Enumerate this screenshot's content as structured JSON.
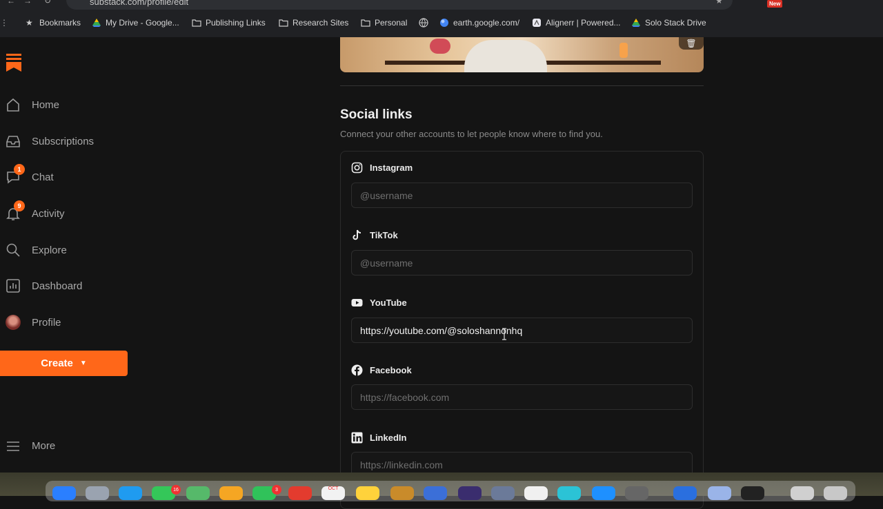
{
  "browser": {
    "url": "substack.com/profile/edit",
    "new_badge": "New",
    "bookmarks": [
      {
        "label": "Bookmarks",
        "icon": "star-icon"
      },
      {
        "label": "My Drive - Google...",
        "icon": "google-drive-icon"
      },
      {
        "label": "Publishing Links",
        "icon": "folder-icon"
      },
      {
        "label": "Research Sites",
        "icon": "folder-icon"
      },
      {
        "label": "Personal",
        "icon": "folder-icon"
      },
      {
        "label": "",
        "icon": "globe-icon"
      },
      {
        "label": "earth.google.com/",
        "icon": "google-earth-icon"
      },
      {
        "label": "Alignerr | Powered...",
        "icon": "alignerr-icon"
      },
      {
        "label": "Solo Stack Drive",
        "icon": "google-drive-icon"
      }
    ]
  },
  "sidebar": {
    "items": [
      {
        "label": "Home",
        "icon": "home-icon"
      },
      {
        "label": "Subscriptions",
        "icon": "inbox-icon"
      },
      {
        "label": "Chat",
        "icon": "chat-icon",
        "badge": "1"
      },
      {
        "label": "Activity",
        "icon": "bell-icon",
        "badge": "9"
      },
      {
        "label": "Explore",
        "icon": "search-icon"
      },
      {
        "label": "Dashboard",
        "icon": "chart-icon"
      },
      {
        "label": "Profile",
        "icon": "avatar"
      }
    ],
    "create_label": "Create",
    "more_label": "More"
  },
  "social": {
    "title": "Social links",
    "subtitle": "Connect your other accounts to let people know where to find you.",
    "fields": [
      {
        "label": "Instagram",
        "icon": "instagram-icon",
        "value": "",
        "placeholder": "@username"
      },
      {
        "label": "TikTok",
        "icon": "tiktok-icon",
        "value": "",
        "placeholder": "@username"
      },
      {
        "label": "YouTube",
        "icon": "youtube-icon",
        "value": "https://youtube.com/@soloshannonhq",
        "placeholder": ""
      },
      {
        "label": "Facebook",
        "icon": "facebook-icon",
        "value": "",
        "placeholder": "https://facebook.com"
      },
      {
        "label": "LinkedIn",
        "icon": "linkedin-icon",
        "value": "",
        "placeholder": "https://linkedin.com"
      }
    ]
  },
  "dock": {
    "badges": [
      "16",
      "3"
    ],
    "calendar_month": "OCT"
  },
  "colors": {
    "accent": "#ff6719",
    "background": "#141414",
    "input_border": "#2e2e2e"
  }
}
